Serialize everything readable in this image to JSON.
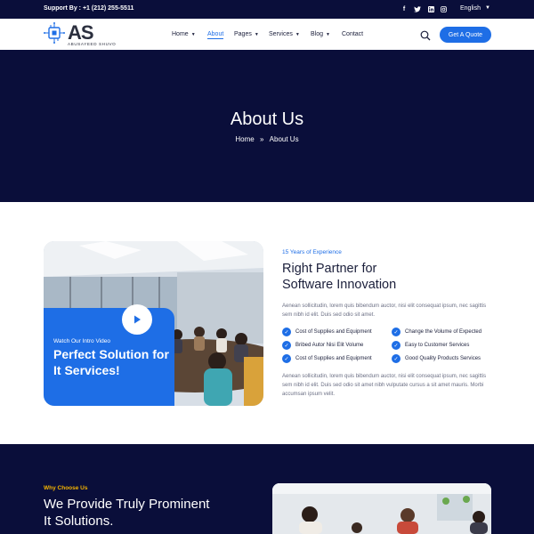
{
  "topbar": {
    "support": "Support By : +1 (212) 255-5511",
    "social_icons": [
      "facebook-icon",
      "twitter-icon",
      "linkedin-icon",
      "instagram-icon"
    ],
    "language": "English"
  },
  "nav": {
    "logo_letters": "AS",
    "logo_sub": "ABUSAYEED SHUVO",
    "items": [
      {
        "label": "Home",
        "has_dropdown": true
      },
      {
        "label": "About",
        "has_dropdown": false,
        "active": true
      },
      {
        "label": "Pages",
        "has_dropdown": true
      },
      {
        "label": "Services",
        "has_dropdown": true
      },
      {
        "label": "Blog",
        "has_dropdown": true
      },
      {
        "label": "Contact",
        "has_dropdown": false
      }
    ],
    "cta": "Get A Quote"
  },
  "hero": {
    "title": "About Us",
    "breadcrumb_home": "Home",
    "breadcrumb_sep": "»",
    "breadcrumb_current": "About Us"
  },
  "about": {
    "watch_label": "Watch Our Intro Video",
    "video_title": "Perfect Solution for It Services!",
    "experience": "15 Years of Experience",
    "heading_line1": "Right Partner for",
    "heading_line2": "Software Innovation",
    "para1": "Aenean sollicitudin, lorem quis bibendum auctor, nisi elit consequat ipsum, nec sagittis sem nibh id elit. Duis sed odio sit amet.",
    "features": [
      "Cost of Supplies and Equipment",
      "Change the Volume of Expected",
      "Bribed Autor Nisi Elit Volume",
      "Easy to Customer Services",
      "Cost of Supplies and Equipment",
      "Good Quality Products Services"
    ],
    "para2": "Aenean sollicitudin, lorem quis bibendum auctor, nisi elit consequat ipsum, nec sagittis sem nibh id elit. Duis sed odio sit amet nibh vulputate cursus a sit amet mauris. Morbi accumsan ipsum velit."
  },
  "why": {
    "tag": "Why Choose Us",
    "title_line1": "We Provide Truly Prominent",
    "title_line2": "It Solutions."
  },
  "colors": {
    "navy": "#0a0e3a",
    "accent": "#1e6ee6",
    "gold": "#f5b400"
  }
}
